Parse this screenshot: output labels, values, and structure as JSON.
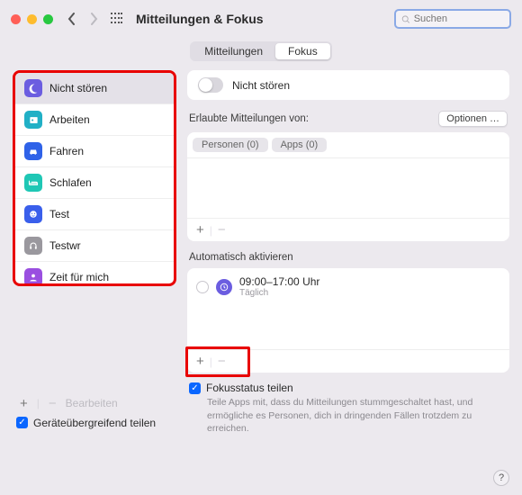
{
  "header": {
    "title": "Mitteilungen & Fokus",
    "search_placeholder": "Suchen"
  },
  "tabs": {
    "left": "Mitteilungen",
    "right": "Fokus"
  },
  "sidebar": {
    "items": [
      {
        "label": "Nicht stören",
        "icon": "moon",
        "color": "#6b5de0"
      },
      {
        "label": "Arbeiten",
        "icon": "id",
        "color": "#21b0c6"
      },
      {
        "label": "Fahren",
        "icon": "car",
        "color": "#2f62e8"
      },
      {
        "label": "Schlafen",
        "icon": "bed",
        "color": "#1fc7b5"
      },
      {
        "label": "Test",
        "icon": "face",
        "color": "#3a5feb"
      },
      {
        "label": "Testwr",
        "icon": "head",
        "color": "#9a989e"
      },
      {
        "label": "Zeit für mich",
        "icon": "person",
        "color": "#9a4fe0"
      }
    ],
    "edit_label": "Bearbeiten"
  },
  "share_all": {
    "label": "Geräteübergreifend teilen"
  },
  "main": {
    "toggle_label": "Nicht stören",
    "allowed": {
      "title": "Erlaubte Mitteilungen von:",
      "options_label": "Optionen …",
      "pills": {
        "people": "Personen (0)",
        "apps": "Apps (0)"
      }
    },
    "auto": {
      "title": "Automatisch aktivieren",
      "schedule": {
        "time": "09:00–17:00 Uhr",
        "repeat": "Täglich"
      }
    },
    "share_status": {
      "title": "Fokusstatus teilen",
      "sub": "Teile Apps mit, dass du Mitteilungen stummgeschaltet hast, und ermögliche es Personen, dich in dringenden Fällen trotzdem zu erreichen."
    }
  },
  "glyphs": {
    "plus": "+",
    "minus": "−"
  }
}
